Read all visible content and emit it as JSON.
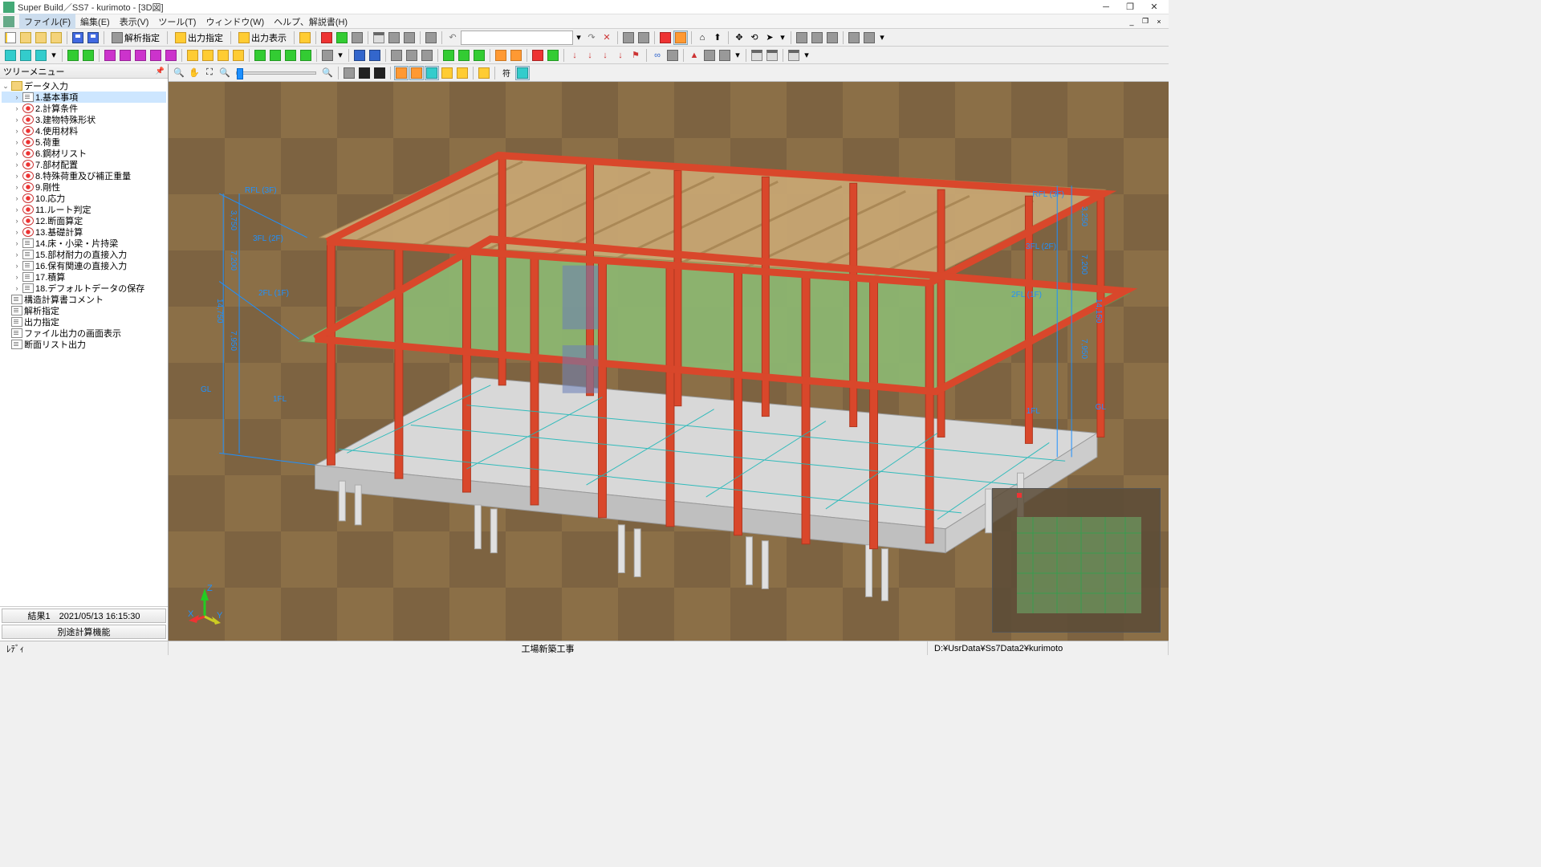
{
  "window": {
    "title": "Super Build／SS7 - kurimoto - [3D図]",
    "mdi_minimize": "_",
    "mdi_restore": "❐",
    "mdi_close": "×"
  },
  "menu": {
    "file": "ファイル(F)",
    "edit": "編集(E)",
    "view": "表示(V)",
    "tool": "ツール(T)",
    "window": "ウィンドウ(W)",
    "help": "ヘルプ、解説書(H)"
  },
  "toolbar1": {
    "analysis_spec": "解析指定",
    "output_spec": "出力指定",
    "output_disp": "出力表示"
  },
  "viewtb": {
    "sym": "符"
  },
  "tree": {
    "title": "ツリーメニュー",
    "root": "データ入力",
    "items": [
      {
        "label": "1.基本事項",
        "selected": true,
        "icon": "doc"
      },
      {
        "label": "2.計算条件",
        "icon": "gear"
      },
      {
        "label": "3.建物特殊形状",
        "icon": "gear"
      },
      {
        "label": "4.使用材料",
        "icon": "gear"
      },
      {
        "label": "5.荷重",
        "icon": "gear"
      },
      {
        "label": "6.鋼材リスト",
        "icon": "gear"
      },
      {
        "label": "7.部材配置",
        "icon": "gear"
      },
      {
        "label": "8.特殊荷重及び補正重量",
        "icon": "gear"
      },
      {
        "label": "9.剛性",
        "icon": "gear"
      },
      {
        "label": "10.応力",
        "icon": "gear"
      },
      {
        "label": "11.ルート判定",
        "icon": "gear"
      },
      {
        "label": "12.断面算定",
        "icon": "gear"
      },
      {
        "label": "13.基礎計算",
        "icon": "gear"
      },
      {
        "label": "14.床・小梁・片持梁",
        "icon": "doc"
      },
      {
        "label": "15.部材耐力の直接入力",
        "icon": "doc"
      },
      {
        "label": "16.保有関連の直接入力",
        "icon": "doc"
      },
      {
        "label": "17.積算",
        "icon": "doc"
      },
      {
        "label": "18.デフォルトデータの保存",
        "icon": "doc"
      }
    ],
    "extra": [
      {
        "label": "構造計算書コメント",
        "icon": "doc"
      },
      {
        "label": "解析指定",
        "icon": "doc"
      },
      {
        "label": "出力指定",
        "icon": "doc"
      },
      {
        "label": "ファイル出力の画面表示",
        "icon": "doc"
      },
      {
        "label": "断面リスト出力",
        "icon": "doc"
      }
    ],
    "footer1": "結果1　2021/05/13 16:15:30",
    "footer2": "別途計算機能"
  },
  "dims": {
    "left": [
      {
        "label": "RFL (3F)"
      },
      {
        "label": "3FL (2F)"
      },
      {
        "label": "2FL (1F)"
      },
      {
        "label": "1FL"
      },
      {
        "label": "GL"
      }
    ],
    "right": [
      {
        "label": "RFL (3F)"
      },
      {
        "label": "3FL (2F)"
      },
      {
        "label": "2FL (1F)"
      },
      {
        "label": "1FL"
      },
      {
        "label": "GL"
      }
    ],
    "heights_left": [
      "3,750",
      "7,200",
      "14,750",
      "7,950"
    ],
    "heights_right": [
      "3,250",
      "7,200",
      "14,150",
      "7,950"
    ]
  },
  "axis": {
    "x": "X",
    "y": "Y",
    "z": "Z"
  },
  "status": {
    "ready": "ﾚﾃﾞｨ",
    "project": "工場新築工事",
    "path": "D:¥UsrData¥Ss7Data2¥kurimoto"
  }
}
